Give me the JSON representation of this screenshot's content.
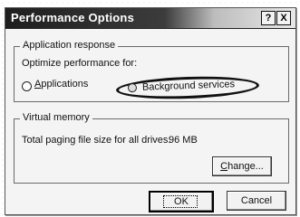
{
  "window": {
    "title": "Performance Options",
    "help_label": "?",
    "close_label": "X"
  },
  "app_response": {
    "legend": "Application response",
    "optimize_label": "Optimize performance for:",
    "options": [
      {
        "label_first": "A",
        "label_rest": "pplications",
        "selected": false
      },
      {
        "label": "Background services",
        "selected": true
      }
    ]
  },
  "virtual_memory": {
    "legend": "Virtual memory",
    "paging_label": "Total paging file size for all drives:",
    "paging_value": "96 MB",
    "change_button_first": "C",
    "change_button_rest": "hange..."
  },
  "buttons": {
    "ok": "OK",
    "cancel": "Cancel"
  }
}
